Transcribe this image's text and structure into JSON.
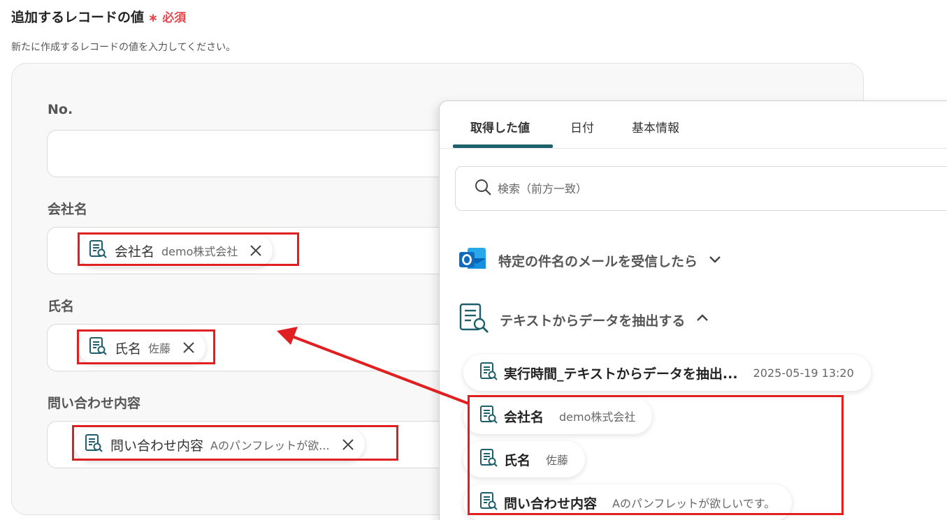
{
  "header": {
    "title": "追加するレコードの値",
    "required_mark": "∗",
    "required_label": "必須",
    "subtitle": "新たに作成するレコードの値を入力してください。"
  },
  "form": {
    "fields": [
      {
        "label": "No.",
        "value": ""
      },
      {
        "label": "会社名",
        "chip_name": "会社名",
        "chip_value": "demo株式会社"
      },
      {
        "label": "氏名",
        "chip_name": "氏名",
        "chip_value": "佐藤"
      },
      {
        "label": "問い合わせ内容",
        "chip_name": "問い合わせ内容",
        "chip_value": "Aのパンフレットが欲..."
      }
    ]
  },
  "dropdown": {
    "tabs": [
      {
        "label": "取得した値",
        "active": true
      },
      {
        "label": "日付",
        "active": false
      },
      {
        "label": "基本情報",
        "active": false
      }
    ],
    "search": {
      "placeholder": "検索（前方一致）"
    },
    "sections": [
      {
        "label": "特定の件名のメールを受信したら",
        "icon": "outlook-icon",
        "expanded": false
      },
      {
        "label": "テキストからデータを抽出する",
        "icon": "document-search-icon",
        "expanded": true
      }
    ],
    "items": [
      {
        "name": "実行時間_テキストからデータを抽出...",
        "value": "2025-05-19 13:20"
      },
      {
        "name": "会社名",
        "value": "demo株式会社"
      },
      {
        "name": "氏名",
        "value": "佐藤"
      },
      {
        "name": "問い合わせ内容",
        "value": "Aのパンフレットが欲しいです。"
      }
    ]
  },
  "colors": {
    "accent": "#1d5f6b",
    "highlight": "#e02020",
    "required": "#e5484d",
    "outlook_blue": "#0f6cbd"
  }
}
